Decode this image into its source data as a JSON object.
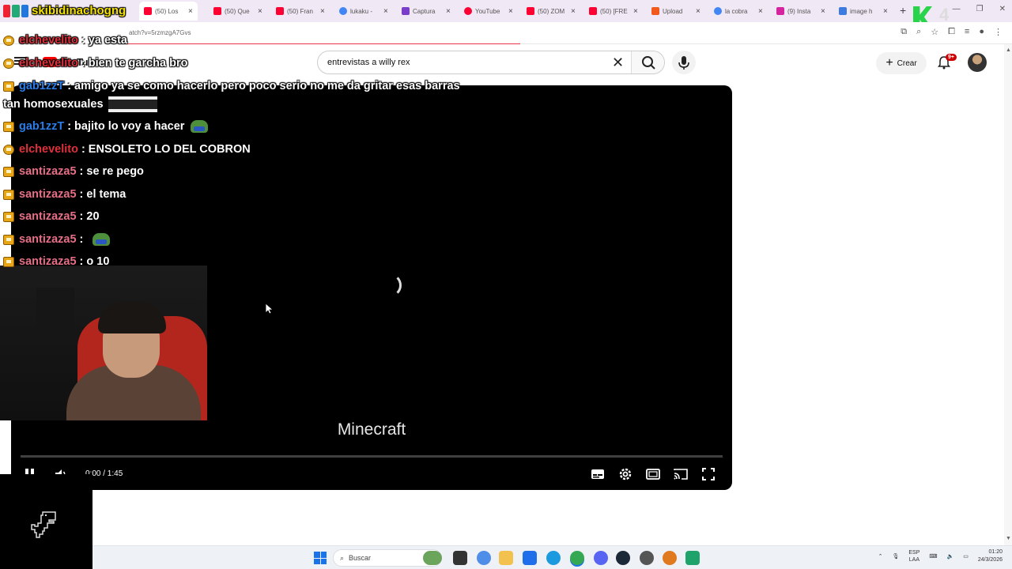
{
  "stream": {
    "title": "skibidinachogng"
  },
  "tabs": [
    {
      "title": "(50) Los",
      "color": "#ff0033",
      "active": true
    },
    {
      "title": "(50) Que",
      "color": "#ff0033"
    },
    {
      "title": "(50) Fran",
      "color": "#ff0033"
    },
    {
      "title": "lukaku -",
      "color": "#4285f4"
    },
    {
      "title": "Captura",
      "color": "#7a3ec9"
    },
    {
      "title": "YouTube",
      "color": "#ff0033"
    },
    {
      "title": "(50) ZOM",
      "color": "#ff0033"
    },
    {
      "title": "(50) [FRE",
      "color": "#ff0033"
    },
    {
      "title": "Upload",
      "color": "#f25a1d"
    },
    {
      "title": "la cobra",
      "color": "#4285f4"
    },
    {
      "title": "(9) Insta",
      "color": "#d6249f"
    },
    {
      "title": "image h",
      "color": "#3d7be0"
    }
  ],
  "address": {
    "url": "atch?v=5rzmzgA7Gvs"
  },
  "youtube": {
    "logo": "YouTube",
    "search_value": "entrevistas a willy rex",
    "create_label": "Crear",
    "notif_count": "9+"
  },
  "chat": [
    {
      "user": "elchevelito",
      "color": "#e0313b",
      "text": "ya esta",
      "badge": "round"
    },
    {
      "user": "elchevelito",
      "color": "#e0313b",
      "text": "bien te garcha bro",
      "badge": "round"
    },
    {
      "user": "gab1zzT",
      "color": "#2b7de9",
      "text": "amigo ya se como hacerlo pero poco serio no me da gritar esas barras",
      "badge": "square"
    },
    {
      "user": "",
      "color": "#ffffff",
      "text": "tan homosexuales",
      "badge": "none"
    },
    {
      "user": "gab1zzT",
      "color": "#2b7de9",
      "text": "bajito lo voy a hacer",
      "badge": "square",
      "emote": true
    },
    {
      "user": "elchevelito",
      "color": "#e0313b",
      "text": "ENSOLETO LO DEL COBRON",
      "badge": "round"
    },
    {
      "user": "santizaza5",
      "color": "#e66f86",
      "text": "se re pego",
      "badge": "square"
    },
    {
      "user": "santizaza5",
      "color": "#e66f86",
      "text": "el tema",
      "badge": "square"
    },
    {
      "user": "santizaza5",
      "color": "#e66f86",
      "text": "20",
      "badge": "square"
    },
    {
      "user": "santizaza5",
      "color": "#e66f86",
      "text": "",
      "badge": "square",
      "emote": true
    },
    {
      "user": "santizaza5",
      "color": "#e66f86",
      "text": "o 10",
      "badge": "square"
    }
  ],
  "player": {
    "video_title": "Minecraft",
    "time": "0:00 / 1:45",
    "progress": 0
  },
  "taskbar": {
    "search_placeholder": "Buscar",
    "lang_top": "ESP",
    "lang_bottom": "LAA",
    "time": "01:20",
    "date": "24/3/2026"
  }
}
